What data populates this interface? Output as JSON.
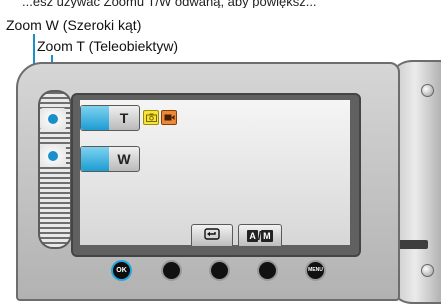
{
  "caption_top": "...esz używać Zoomu T/W odwaną, aby powiększ...",
  "callouts": {
    "zoom_w": "Zoom W (Szeroki kąt)",
    "zoom_t": "Zoom T (Teleobiektyw)"
  },
  "screen": {
    "t_button": "T",
    "w_button": "W",
    "photo_icon": "photo-mode-icon",
    "video_icon": "video-mode-icon",
    "return_icon": "return-icon",
    "am_tab": {
      "a": "A",
      "separator": "/",
      "m": "M"
    }
  },
  "hardware": {
    "ok_label": "OK",
    "menu_label": "MENU"
  },
  "colors": {
    "leader_line": "#1a8fc9",
    "button_accent": "#1c9dd3",
    "ok_ring": "#26a6e0"
  }
}
